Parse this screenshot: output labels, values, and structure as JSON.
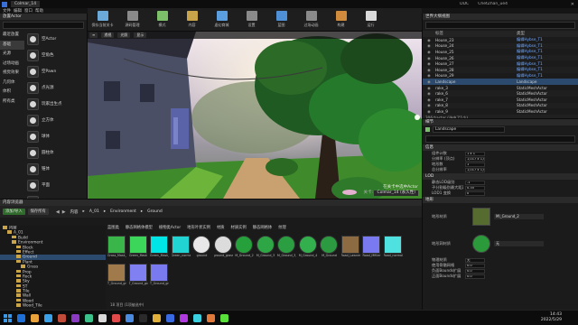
{
  "window": {
    "title": "Colmar_14",
    "tabs": [
      "DDC",
      "ChetZhan_ue4"
    ]
  },
  "menu": [
    "文件",
    "编辑",
    "窗口",
    "帮助"
  ],
  "toolbar": [
    {
      "label": "保存当前关卡",
      "color": "#6aa9d8"
    },
    {
      "label": "源码管理",
      "color": "#8a8a8a"
    },
    {
      "label": "模式",
      "color": "#7cc06a"
    },
    {
      "label": "内容",
      "color": "#c9a449"
    },
    {
      "label": "虚幻商城",
      "color": "#5a9ee0"
    },
    {
      "label": "设置",
      "color": "#8a8a8a"
    },
    {
      "label": "蓝图",
      "color": "#4f8fd6"
    },
    {
      "label": "过场动画",
      "color": "#8a8a8a"
    },
    {
      "label": "构建",
      "color": "#d08c3c"
    },
    {
      "label": "运行",
      "color": "#dadada"
    }
  ],
  "place_actors": {
    "title": "放置Actor",
    "categories": [
      "最近放置",
      "基础",
      "光源",
      "过场动画",
      "视觉效果",
      "几何体",
      "体积",
      "所有类"
    ],
    "items": [
      "空Actor",
      "空角色",
      "空Pawn",
      "点光源",
      "玩家出生点",
      "立方体",
      "球体",
      "圆柱体",
      "锥体",
      "平面",
      "盒体触发器",
      "球体触发器"
    ]
  },
  "viewport": {
    "buttons": [
      "透视",
      "光照",
      "显示"
    ],
    "selection_text": "在关卡中选中Actor",
    "selection_chip": "Colmar_14 (永久性)"
  },
  "outliner": {
    "title": "世界大纲视图",
    "columns": [
      "标签",
      "类型"
    ],
    "rows": [
      {
        "name": "House_23",
        "type": "编辑Hybse_T1",
        "link": true,
        "sel": false
      },
      {
        "name": "House_24",
        "type": "编辑Hybse_T1",
        "link": true,
        "sel": false
      },
      {
        "name": "House_25",
        "type": "编辑Hybse_T1",
        "link": true,
        "sel": false
      },
      {
        "name": "House_26",
        "type": "编辑Hybse_T1",
        "link": true,
        "sel": false
      },
      {
        "name": "House_27",
        "type": "编辑Hybse_T1",
        "link": true,
        "sel": false
      },
      {
        "name": "House_28",
        "type": "编辑Hybse_T1",
        "link": true,
        "sel": false
      },
      {
        "name": "House_29",
        "type": "编辑Hybse_T1",
        "link": true,
        "sel": false
      },
      {
        "name": "Landscape",
        "type": "Landscape",
        "link": false,
        "sel": true
      },
      {
        "name": "rake_3",
        "type": "StaticMeshActor",
        "link": false,
        "sel": false
      },
      {
        "name": "rake_6",
        "type": "StaticMeshActor",
        "link": false,
        "sel": false
      },
      {
        "name": "rake_7",
        "type": "StaticMeshActor",
        "link": false,
        "sel": false
      },
      {
        "name": "rake_8",
        "type": "StaticMeshActor",
        "link": false,
        "sel": false
      },
      {
        "name": "rake_9",
        "type": "StaticMeshActor",
        "link": false,
        "sel": false
      }
    ],
    "footer": "306个actor (选中了1个)"
  },
  "details": {
    "title": "细节",
    "object": "Landscape",
    "sections": {
      "info": "信息",
      "lod": "LOD",
      "landscape": "地形"
    },
    "info_props": [
      {
        "k": "组件计数",
        "v": "1 x 1"
      },
      {
        "k": "分辨率 (顶点)",
        "v": "1,017 x 1,017"
      },
      {
        "k": "地形数",
        "v": "1"
      },
      {
        "k": "总分辨率",
        "v": "1,017 x 1,017"
      }
    ],
    "lod_props": [
      {
        "k": "静态LOD级别",
        "v": "-1"
      },
      {
        "k": "子分割级别最大距离大于",
        "v": "0.35"
      },
      {
        "k": "LOD1 变换",
        "v": "0"
      }
    ],
    "landscape_material_label": "地形材质",
    "landscape_material": "Ml_Ground_2",
    "hole_material_label": "地形洞材质",
    "hole_material": "无",
    "landscape_props": [
      {
        "k": "物理材质",
        "v": "无"
      },
      {
        "k": "使用骨骼网格",
        "v": "0.0"
      },
      {
        "k": "负面Bounds扩展",
        "v": "0.0"
      },
      {
        "k": "正面Bounds扩展",
        "v": "0.0"
      }
    ]
  },
  "content_browser": {
    "title": "内容浏览器",
    "add_new": "添加/导入",
    "save_all": "保存所有",
    "path": [
      "内容",
      "A_01",
      "Environment",
      "Ground"
    ],
    "filters": [
      "蓝图类",
      "静态网格体模型",
      "植物类Actor",
      "地形叶状实例",
      "材质",
      "材质实例",
      "静态网格体",
      "纹理"
    ],
    "count": "18 项目 (1项被选中)",
    "tree": [
      {
        "t": "内容",
        "d": 0,
        "sel": false
      },
      {
        "t": "A_01",
        "d": 1,
        "sel": false
      },
      {
        "t": "Build",
        "d": 2,
        "sel": false
      },
      {
        "t": "Environment",
        "d": 2,
        "sel": false
      },
      {
        "t": "Block",
        "d": 3,
        "sel": false
      },
      {
        "t": "Effect",
        "d": 3,
        "sel": false
      },
      {
        "t": "Ground",
        "d": 3,
        "sel": true
      },
      {
        "t": "Plant",
        "d": 3,
        "sel": false
      },
      {
        "t": "Grass",
        "d": 4,
        "sel": false
      },
      {
        "t": "Prop",
        "d": 3,
        "sel": false
      },
      {
        "t": "Rock",
        "d": 3,
        "sel": false
      },
      {
        "t": "Sky",
        "d": 3,
        "sel": false
      },
      {
        "t": "ST",
        "d": 3,
        "sel": false
      },
      {
        "t": "Tile",
        "d": 3,
        "sel": false
      },
      {
        "t": "Wall",
        "d": 3,
        "sel": false
      },
      {
        "t": "Wood",
        "d": 3,
        "sel": false
      },
      {
        "t": "Wood_Tile",
        "d": 3,
        "sel": false
      }
    ],
    "assets": [
      {
        "n": "Grass_Mask_normal",
        "c": "#39b54a"
      },
      {
        "n": "Green_Mask",
        "c": "#3bd65a"
      },
      {
        "n": "Green_Mask_normal",
        "c": "#00e5e5"
      },
      {
        "n": "Green_normal",
        "c": "#22d3d3"
      },
      {
        "n": "ground",
        "c": "#e8e8e8"
      },
      {
        "n": "ground_grass",
        "c": "#dcdcdc"
      },
      {
        "n": "M_Ground_2",
        "c": "#26a03a"
      },
      {
        "n": "M_Ground_3",
        "c": "#2fa646"
      },
      {
        "n": "M_Ground_3_Inst",
        "c": "#2a9e40"
      },
      {
        "n": "M_Ground_4",
        "c": "#33b04d"
      },
      {
        "n": "M_Ground",
        "c": "#2c9a40"
      },
      {
        "n": "Road_Lawnmow",
        "c": "#8c6a42"
      },
      {
        "n": "Road_Mfiller",
        "c": "#7a7af0"
      },
      {
        "n": "Road_normal",
        "c": "#4fe0e0"
      },
      {
        "n": "T_Ground_grass_landscape",
        "c": "#a07a4a"
      },
      {
        "n": "T_Ground_grass_Mfiller",
        "c": "#8080f2"
      },
      {
        "n": "T_Ground_grass_normal",
        "c": "#7a7af0"
      }
    ]
  },
  "taskbar": {
    "time": "14:43",
    "date": "2022/5/29",
    "icons": [
      "#1f6fd8",
      "#e8a33a",
      "#3aa0e8",
      "#c24b3a",
      "#8a3ac2",
      "#3ac28a",
      "#d8d8d8",
      "#e04a4a",
      "#4a8ae0",
      "#2a2a2a",
      "#e0b03a",
      "#3a6ae0",
      "#b03ae0",
      "#3ad0e0",
      "#e07a3a",
      "#5ae03a"
    ]
  }
}
